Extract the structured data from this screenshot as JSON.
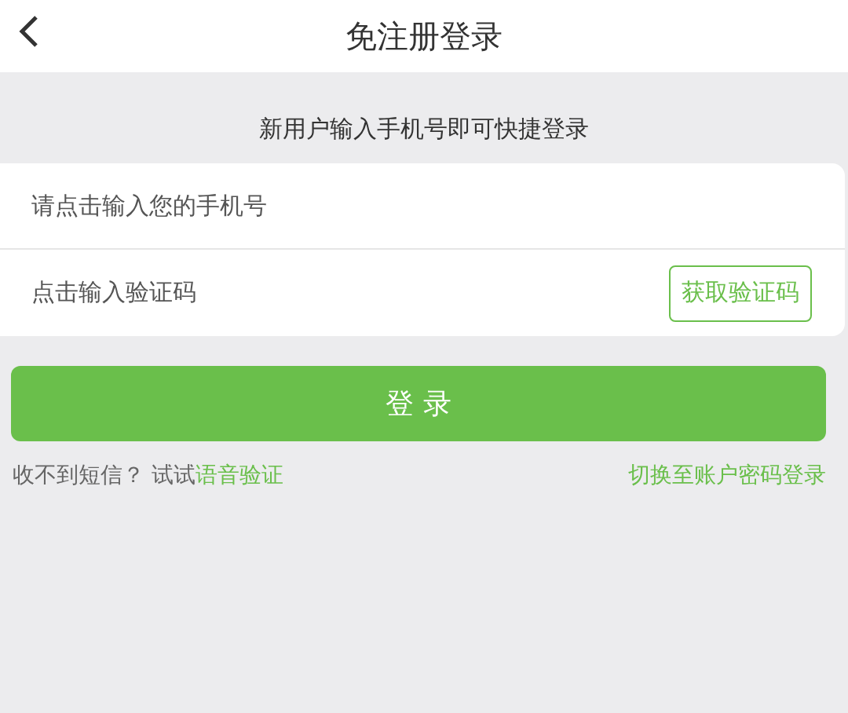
{
  "header": {
    "title": "免注册登录"
  },
  "subtitle": "新用户输入手机号即可快捷登录",
  "phone_field": {
    "placeholder": "请点击输入您的手机号"
  },
  "code_field": {
    "placeholder": "点击输入验证码"
  },
  "get_code_button": "获取验证码",
  "login_button": "登 录",
  "footer": {
    "prompt": "收不到短信？ 试试",
    "voice_link": "语音验证",
    "switch_link": "切换至账户密码登录"
  }
}
